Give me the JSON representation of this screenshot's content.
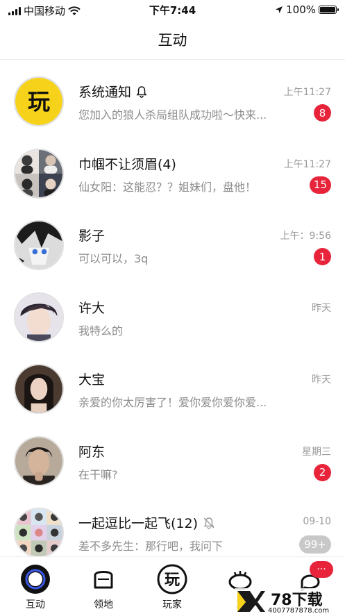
{
  "status_bar": {
    "carrier": "中国移动",
    "time": "下午7:44",
    "battery": "100%"
  },
  "header": {
    "title": "互动"
  },
  "conversations": [
    {
      "title": "系统通知",
      "preview": "您加入的狼人杀局组队成功啦～快来...",
      "time": "上午11:27",
      "badge": "8",
      "muted": false,
      "bell": true
    },
    {
      "title": "巾帼不让须眉(4)",
      "preview": "仙女阳：这能忍？？姐妹们，盘他！",
      "time": "上午11:27",
      "badge": "15"
    },
    {
      "title": "影子",
      "preview": "可以可以，3q",
      "time": "上午：9:56",
      "badge": "1"
    },
    {
      "title": "许大",
      "preview": "我特么的",
      "time": "昨天",
      "badge": ""
    },
    {
      "title": "大宝",
      "preview": "亲爱的你太厉害了！爱你爱你爱你爱...",
      "time": "昨天",
      "badge": ""
    },
    {
      "title": "阿东",
      "preview": "在干嘛?",
      "time": "星期三",
      "badge": "2"
    },
    {
      "title": "一起逗比一起飞(12)",
      "preview": "差不多先生：那行吧，我问下",
      "time": "09-10",
      "badge": "99+",
      "muted": true
    }
  ],
  "avatar_logo_text": "玩",
  "tabbar": {
    "items": [
      {
        "label": "互动"
      },
      {
        "label": "领地"
      },
      {
        "label": "玩家"
      },
      {
        "label": "发"
      },
      {
        "label": ""
      }
    ],
    "chat_badge": "···"
  },
  "watermark": {
    "text": "78下载",
    "url_text": "4007787878.com"
  },
  "colors": {
    "accent": "#e8243b",
    "logo_yellow": "#f6d21b"
  }
}
